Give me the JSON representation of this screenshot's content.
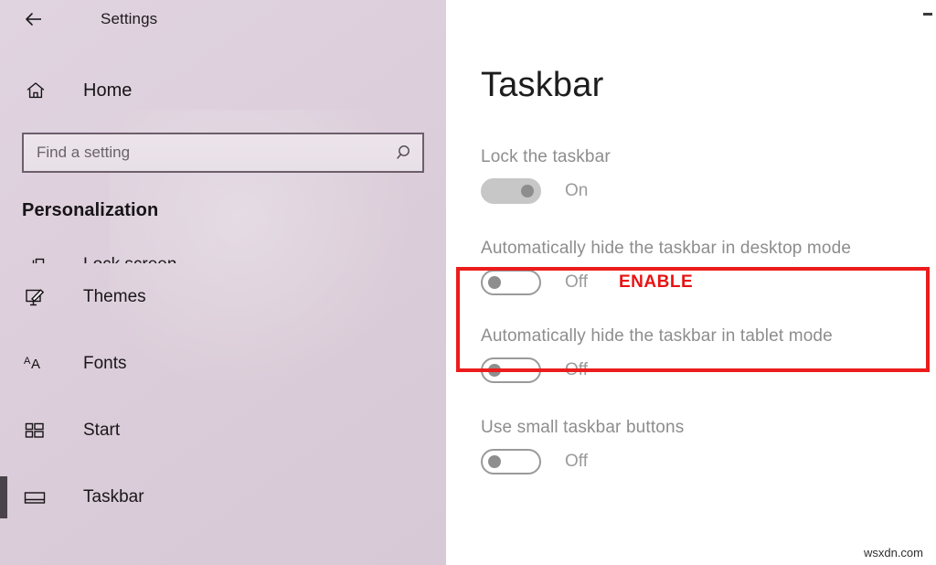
{
  "window": {
    "app_title": "Settings",
    "back_icon": "back-arrow-icon",
    "minimize_icon": "minimize-icon"
  },
  "sidebar": {
    "home": {
      "label": "Home",
      "icon": "home-icon"
    },
    "search": {
      "placeholder": "Find a setting",
      "value": "",
      "icon": "search-icon"
    },
    "section_heading": "Personalization",
    "items": [
      {
        "label": "Lock screen",
        "icon": "lock-screen-icon",
        "selected": false,
        "clipped": true
      },
      {
        "label": "Themes",
        "icon": "themes-brush-icon",
        "selected": false,
        "clipped": false
      },
      {
        "label": "Fonts",
        "icon": "fonts-aa-icon",
        "selected": false,
        "clipped": false
      },
      {
        "label": "Start",
        "icon": "start-tiles-icon",
        "selected": false,
        "clipped": false
      },
      {
        "label": "Taskbar",
        "icon": "taskbar-icon",
        "selected": true,
        "clipped": false
      }
    ]
  },
  "main": {
    "page_title": "Taskbar",
    "settings": [
      {
        "label": "Lock the taskbar",
        "state": "On",
        "toggle": "on"
      },
      {
        "label": "Automatically hide the taskbar in desktop mode",
        "state": "Off",
        "toggle": "off",
        "annotation": "ENABLE",
        "highlighted": true
      },
      {
        "label": "Automatically hide the taskbar in tablet mode",
        "state": "Off",
        "toggle": "off"
      },
      {
        "label": "Use small taskbar buttons",
        "state": "Off",
        "toggle": "off"
      }
    ]
  },
  "watermark": "wsxdn.com",
  "colors": {
    "sidebar_bg": "#ded0dc",
    "highlight_red": "#ec1c1c",
    "annotation_red": "#e81313",
    "label_gray": "#8d8d8d",
    "selection_bar": "#4a4349"
  }
}
